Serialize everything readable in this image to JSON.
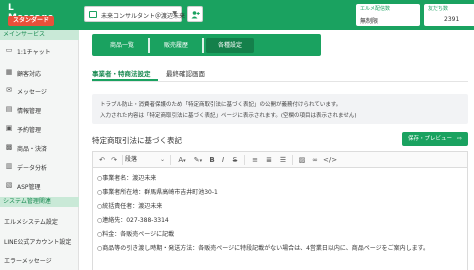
{
  "brand": {
    "title": "L Message",
    "plan": "スタンダード"
  },
  "account": {
    "name": "未来コンサルタント＠渡辺未来"
  },
  "stats": {
    "delivery_label": "エルメ配信数",
    "delivery_value": "無制限",
    "friends_label": "友だち数",
    "friends_value": "2391"
  },
  "sidebar": {
    "main_service_label": "メインサービス",
    "items": [
      {
        "label": "1:1チャット",
        "icon": "chat-icon"
      },
      {
        "label": "顧客対応",
        "icon": "customer-icon"
      },
      {
        "label": "メッセージ",
        "icon": "message-icon"
      },
      {
        "label": "情報管理",
        "icon": "info-icon"
      },
      {
        "label": "予約管理",
        "icon": "calendar-icon"
      },
      {
        "label": "商品・決済",
        "icon": "cart-icon"
      },
      {
        "label": "データ分析",
        "icon": "chart-icon"
      },
      {
        "label": "ASP管理",
        "icon": "asp-icon"
      }
    ],
    "system_label": "システム管理関連",
    "system_items": [
      {
        "label": "エルメシステム設定"
      },
      {
        "label": "LINE公式アカウント設定"
      },
      {
        "label": "エラーメッセージ"
      }
    ]
  },
  "tabs": [
    {
      "label": "商品一覧"
    },
    {
      "label": "販売履歴"
    },
    {
      "label": "各種設定"
    }
  ],
  "subtabs": {
    "first": "事業者・特商法設定",
    "second": "最終確認画面"
  },
  "notice": {
    "line1": "トラブル防止・消費者保護のため「特定商取引法に基づく表記」の公開が義務付けられています。",
    "line2": "入力された内容は「特定商取引法に基づく表記」ページに表示されます。(空欄の項目は表示されません)"
  },
  "section": {
    "title": "特定商取引法に基づく表記",
    "preview_label": "保存・プレビュー"
  },
  "editor": {
    "paragraph_style": "段落",
    "lines": [
      "○事業者名：渡辺未来",
      "○事業者所在地：群馬県高崎市吉井町池30-1",
      "○統括責任者：渡辺未来",
      "○連絡先：027-388-3314",
      "○料金：各販売ページに記載",
      "○商品等の引き渡し時期・発送方法：各販売ページに特段記載がない場合は、4営業日以内に、商品ページをご案内します。"
    ]
  }
}
